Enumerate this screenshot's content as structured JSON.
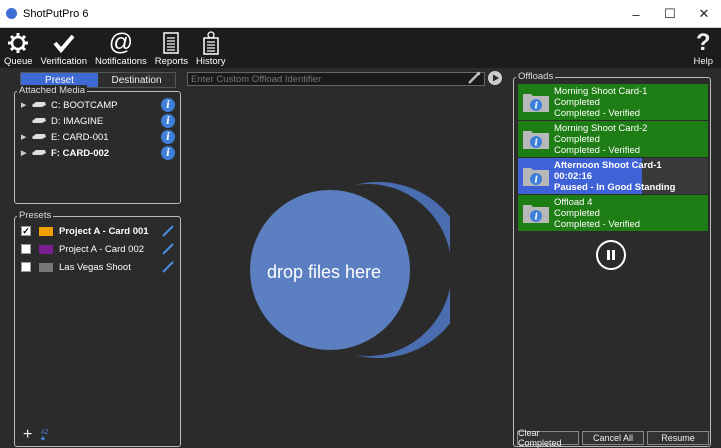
{
  "window": {
    "title": "ShotPutPro 6",
    "minimize": "–",
    "maximize": "☐",
    "close": "✕"
  },
  "toolbar": {
    "queue": "Queue",
    "verification": "Verification",
    "notifications": "Notifications",
    "reports": "Reports",
    "history": "History",
    "help": "Help"
  },
  "tabs": {
    "preset": "Preset",
    "destination": "Destination"
  },
  "attached_media": {
    "title": "Attached Media",
    "items": [
      {
        "label": "C: BOOTCAMP",
        "bold": false,
        "expandable": true
      },
      {
        "label": "D: IMAGINE",
        "bold": false,
        "expandable": false
      },
      {
        "label": "E: CARD-001",
        "bold": false,
        "expandable": true
      },
      {
        "label": "F: CARD-002",
        "bold": true,
        "expandable": true
      }
    ]
  },
  "presets": {
    "title": "Presets",
    "items": [
      {
        "label": "Project A - Card 001",
        "checked": true,
        "color": "#f0a000",
        "bold": true
      },
      {
        "label": "Project A - Card 002",
        "checked": false,
        "color": "#7a1f8f",
        "bold": false
      },
      {
        "label": "Las Vegas Shoot",
        "checked": false,
        "color": "#777777",
        "bold": false
      }
    ]
  },
  "identifier": {
    "placeholder": "Enter Custom Offload Identifier"
  },
  "drop_zone": {
    "text": "drop files here",
    "color": "#5b7fc0"
  },
  "offloads": {
    "title": "Offloads",
    "items": [
      {
        "lines": [
          "Morning Shoot Card-1",
          "Completed",
          "Completed - Verified"
        ],
        "status": "complete",
        "bg": "#1e7d14"
      },
      {
        "lines": [
          "Morning Shoot Card-2",
          "Completed",
          "Completed - Verified"
        ],
        "status": "complete",
        "bg": "#1e7d14"
      },
      {
        "lines": [
          "Afternoon Shoot Card-1",
          "00:02:16",
          "Paused - In Good Standing"
        ],
        "status": "paused",
        "bg": "#3f63d6"
      },
      {
        "lines": [
          "Offload 4",
          "Completed",
          "Completed - Verified"
        ],
        "status": "complete",
        "bg": "#1e7d14"
      }
    ]
  },
  "buttons": {
    "clear_completed": "Clear Completed",
    "cancel_all": "Cancel All",
    "resume": "Resume"
  },
  "colors": {
    "accent": "#3f6ad1",
    "success": "#1e7d14",
    "background": "#2b2b2b"
  }
}
